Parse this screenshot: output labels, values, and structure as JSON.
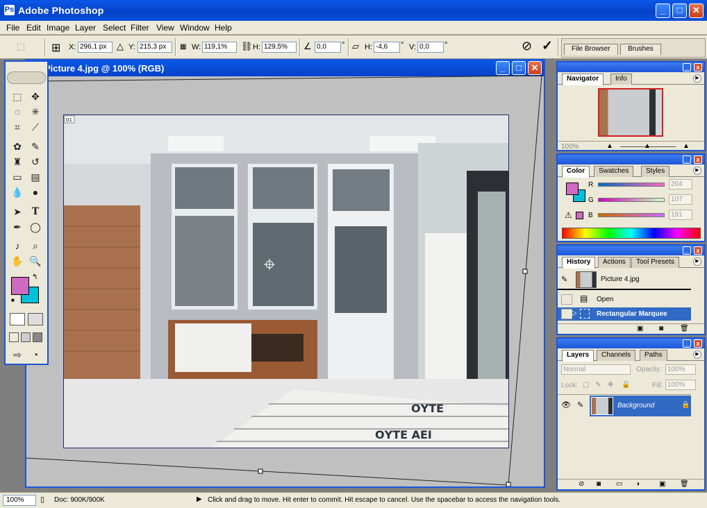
{
  "app": {
    "title": "Adobe Photoshop",
    "logo": "Ps"
  },
  "window_controls": {
    "minimize": "_",
    "maximize": "□",
    "close": "✕"
  },
  "menu": [
    "File",
    "Edit",
    "Image",
    "Layer",
    "Select",
    "Filter",
    "View",
    "Window",
    "Help"
  ],
  "options": {
    "x_label": "X:",
    "x_value": "296,1 px",
    "y_label": "Y:",
    "y_value": "215,3 px",
    "w_label": "W:",
    "w_value": "119,1%",
    "h_label": "H:",
    "h_value": "129,5%",
    "angle_value": "0,0",
    "angle_unit": "°",
    "hskew_label": "H:",
    "hskew_value": "-4,6",
    "hskew_unit": "°",
    "vskew_label": "V:",
    "vskew_value": "0,0",
    "vskew_unit": "°",
    "cancel_symbol": "⊘",
    "commit_symbol": "✓"
  },
  "well_tabs": [
    "File Browser",
    "Brushes"
  ],
  "document": {
    "title": "Picture 4.jpg @ 100% (RGB)",
    "slice_label": "01"
  },
  "navigator": {
    "tabs": [
      "Navigator",
      "Info"
    ],
    "zoom": "100%"
  },
  "color": {
    "tabs": [
      "Color",
      "Swatches",
      "Styles"
    ],
    "r_label": "R",
    "r_value": "204",
    "g_label": "G",
    "g_value": "107",
    "b_label": "B",
    "b_value": "191",
    "foreground": "#cc6bbf",
    "background": "#00c0d8"
  },
  "history": {
    "tabs": [
      "History",
      "Actions",
      "Tool Presets"
    ],
    "snapshot": "Picture 4.jpg",
    "items": [
      "Open",
      "Rectangular Marquee"
    ]
  },
  "layers": {
    "tabs": [
      "Layers",
      "Channels",
      "Paths"
    ],
    "blend_mode": "Normal",
    "opacity_label": "Opacity:",
    "opacity_value": "100%",
    "lock_label": "Lock:",
    "fill_label": "Fill:",
    "fill_value": "100%",
    "layer_name": "Background"
  },
  "status": {
    "zoom": "100%",
    "doc": "Doc: 900K/900K",
    "hint": "Click and drag to move. Hit enter to commit. Hit escape to cancel. Use the spacebar to access the navigation tools."
  },
  "colors": {
    "accent": "#1b56d9",
    "panel_bg": "#ece9d8",
    "selection": "#316ac5"
  },
  "canvas_signs": {
    "sign1": "ΟΥΤΕ",
    "sign2": "ΟΥΤΕ ΑΕΙ"
  }
}
